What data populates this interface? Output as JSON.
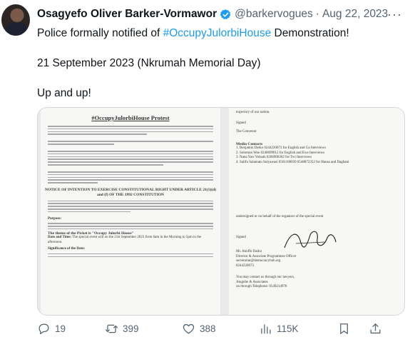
{
  "tweet": {
    "author_name": "Osagyefo Oliver Barker-Vormawor",
    "handle": "@barkervogues",
    "separator": "·",
    "date": "Aug 22, 2023",
    "text_intro": "Police formally notified of ",
    "hashtag": "#OccupyJulorbiHouse",
    "text_outro": " Demonstration!",
    "line2": "21 September 2023 (Nkrumah Memorial Day)",
    "line3": "Up and up!"
  },
  "media": {
    "doc_title": "#OccupyJulorbiHouse Protest",
    "notice_heading": "NOTICE OF INTENTION TO EXERCISE CONSTITUTIONAL RIGHT UNDER ARTICLE 21(1)(d) and (f) OF THE 1992 CONSTITUTION",
    "right_top_1": "trajectory of our nation.",
    "right_signed": "Signed",
    "right_convenor": "The Convenor",
    "media_contacts": "Media Contacts",
    "contacts": [
      "1. Benjamin Darko 0244220073 for English and Ga Interviews",
      "2. Solomon Woe 0240699012 for English and Ewe Interviews",
      "3. Nana Yaw Yeboah 0266900302 for Twi Interviews",
      "4. Salifu Salamatu Sulyawasi 0501100039 0548872352 for Hausa and Dagbani"
    ],
    "undersigned": "undersigned or on behalf of the organiser of the special event",
    "signed2": "Signed",
    "signatory_name": "Mr. Akoffo Darko",
    "signatory_title": "Director & Associate Programmes Officer",
    "signatory_email": "secretariat@democracyhub.org",
    "signatory_phone": "0244220073",
    "lawyers_1": "You may contact us through our lawyers,",
    "lawyers_2": "Atugube & Associates",
    "lawyers_3": "on through Telephone: 0549214976",
    "purpose_label": "Purpose:",
    "theme_label": "The theme of the Picket is \"Occupy Julorbi House\"",
    "date_time_label": "Date and Time:",
    "date_time_text": "The special event will on the 21st September 2023 from 6am in the Morning to 5pm in the afternoon.",
    "significance_label": "Significance of the Date:"
  },
  "actions": {
    "replies": "19",
    "reposts": "399",
    "likes": "388",
    "views": "115K"
  },
  "colors": {
    "text": "#0f1419",
    "secondary": "#536471",
    "accent": "#1d9bf0",
    "border": "#cfd9de"
  }
}
